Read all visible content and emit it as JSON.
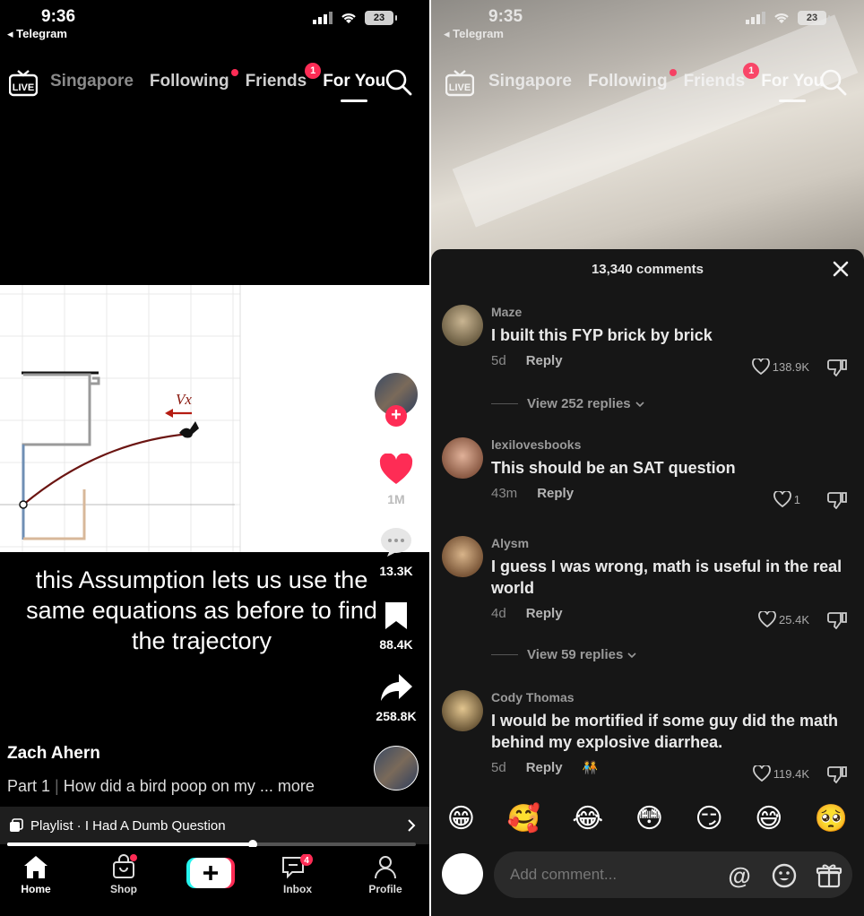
{
  "left": {
    "status": {
      "time": "9:36",
      "back_app": "◂ Telegram",
      "battery": "23"
    },
    "topnav": {
      "tabs": [
        {
          "label": "Singapore",
          "style": "dim"
        },
        {
          "label": "Following",
          "indicator": "dot"
        },
        {
          "label": "Friends",
          "badge": "1"
        },
        {
          "label": "For You",
          "active": true
        }
      ]
    },
    "video": {
      "caption": "this Assumption lets us use the same equations as before to find the trajectory",
      "graph_label": "Vx"
    },
    "rail": {
      "likes": "1M",
      "comments": "13.3K",
      "bookmarks": "88.4K",
      "shares": "258.8K"
    },
    "author": "Zach Ahern",
    "description": {
      "part": "Part 1",
      "text": "How did a bird poop on my ... more"
    },
    "playlist": "Playlist · I Had A Dumb Question",
    "progress_fraction": 0.6,
    "bottomnav": [
      {
        "label": "Home",
        "active": true
      },
      {
        "label": "Shop",
        "indicator": "dot"
      },
      {
        "label": "",
        "create": true
      },
      {
        "label": "Inbox",
        "badge": "4"
      },
      {
        "label": "Profile"
      }
    ]
  },
  "right": {
    "status": {
      "time": "9:35",
      "back_app": "◂ Telegram",
      "battery": "23"
    },
    "topnav": {
      "tabs": [
        {
          "label": "Singapore",
          "style": "dim"
        },
        {
          "label": "Following",
          "indicator": "dot"
        },
        {
          "label": "Friends",
          "badge": "1"
        },
        {
          "label": "For You",
          "active": true
        }
      ]
    },
    "comments_title": "13,340 comments",
    "comments": [
      {
        "user": "Maze",
        "text": "I built this FYP brick by brick",
        "age": "5d",
        "reply": "Reply",
        "likes": "138.9K",
        "view_replies": "View 252 replies"
      },
      {
        "user": "lexilovesbooks",
        "text": "This should be an SAT question",
        "age": "43m",
        "reply": "Reply",
        "likes": "1"
      },
      {
        "user": "Alysm",
        "text": "I guess I was wrong, math is useful in the real world",
        "age": "4d",
        "reply": "Reply",
        "likes": "25.4K",
        "view_replies": "View 59 replies"
      },
      {
        "user": "Cody Thomas",
        "text": "I would be mortified if some guy did the math behind my explosive diarrhea.",
        "age": "5d",
        "reply": "Reply",
        "likes": "119.4K"
      }
    ],
    "emojis": [
      "😁",
      "🥰",
      "😂",
      "😳",
      "😏",
      "😅",
      "🥺"
    ],
    "input": {
      "placeholder": "Add comment..."
    }
  }
}
